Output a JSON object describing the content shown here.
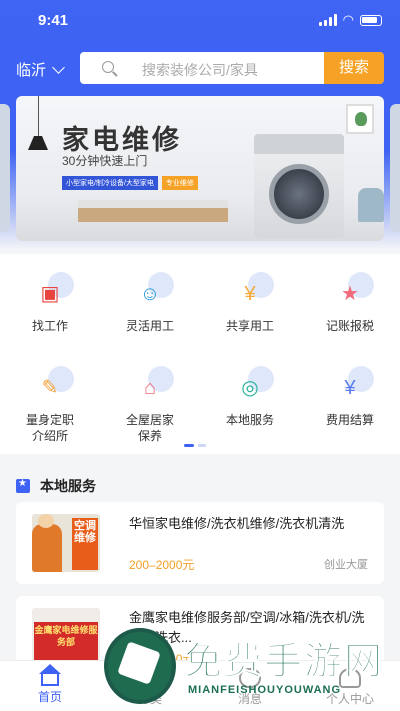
{
  "status": {
    "time": "9:41"
  },
  "header": {
    "city": "临沂",
    "search_placeholder": "搜索装修公司/家具",
    "search_button": "搜索"
  },
  "banner": {
    "title": "家电维修",
    "subtitle": "30分钟快速上门",
    "tag1": "小型家电/制冷设备/大型家电",
    "tag2": "专业维修"
  },
  "menu": {
    "items": [
      {
        "label": "找工作",
        "icon": "briefcase-icon",
        "color": "#e8433e"
      },
      {
        "label": "灵活用工",
        "icon": "worker-icon",
        "color": "#2b9ad9"
      },
      {
        "label": "共享用工",
        "icon": "coin-icon",
        "color": "#f2a73b"
      },
      {
        "label": "记账报税",
        "icon": "badge-icon",
        "color": "#f06a7a"
      },
      {
        "label": "量身定职介绍所",
        "icon": "pencil-ruler-icon",
        "color": "#f5a23a"
      },
      {
        "label": "全屋居家保养",
        "icon": "house-icon",
        "color": "#f06a7a"
      },
      {
        "label": "本地服务",
        "icon": "target-icon",
        "color": "#27b39a"
      },
      {
        "label": "费用结算",
        "icon": "yen-card-icon",
        "color": "#5b7cf0"
      }
    ]
  },
  "local": {
    "title": "本地服务",
    "cards": [
      {
        "title": "华恒家电维修/洗衣机维修/洗衣机清洗",
        "price": "200–2000元",
        "location": "创业大厦",
        "thumb_text": "空调维修"
      },
      {
        "title": "金鹰家电维修服务部/空调/冰箱/洗衣机/洗衣机洗衣...",
        "price": "200–2000元",
        "location": "",
        "thumb_text": "金鹰家电维修服务部"
      }
    ]
  },
  "tabbar": {
    "tabs": [
      {
        "label": "首页",
        "active": true
      },
      {
        "label": "分类",
        "active": false
      },
      {
        "label": "消息",
        "active": false
      },
      {
        "label": "个人中心",
        "active": false
      }
    ]
  },
  "watermark": {
    "big": "免费手游网",
    "small": "MIANFEISHOUYOUWANG"
  },
  "colors": {
    "primary": "#3e62f3",
    "accent": "#f6a226",
    "price": "#f2a028"
  }
}
